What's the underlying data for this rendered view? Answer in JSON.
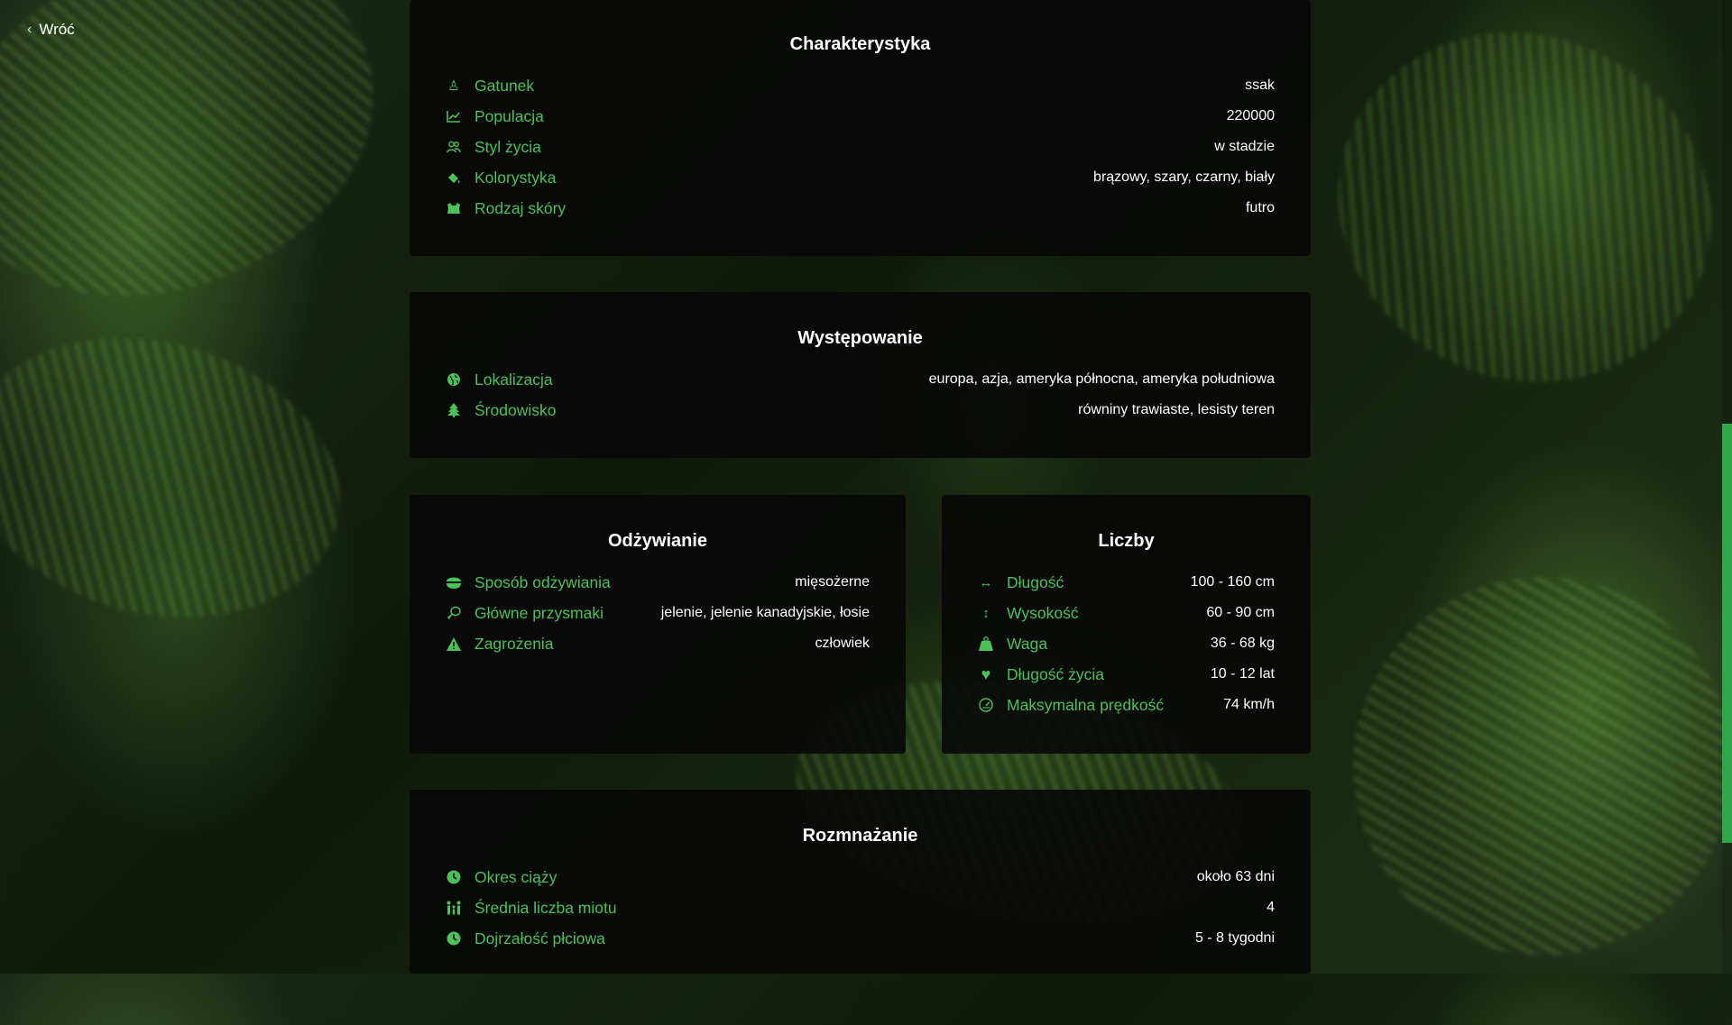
{
  "nav": {
    "back_label": "Wróć"
  },
  "sections": {
    "charakterystyka": {
      "title": "Charakterystyka",
      "rows": [
        {
          "icon": "species-icon",
          "label": "Gatunek",
          "value": "ssak"
        },
        {
          "icon": "chart-line-icon",
          "label": "Populacja",
          "value": "220000"
        },
        {
          "icon": "users-icon",
          "label": "Styl życia",
          "value": "w stadzie"
        },
        {
          "icon": "paint-bucket-icon",
          "label": "Kolorystyka",
          "value": "brązowy, szary, czarny, biały"
        },
        {
          "icon": "skin-icon",
          "label": "Rodzaj skóry",
          "value": "futro"
        }
      ]
    },
    "wystepowanie": {
      "title": "Występowanie",
      "rows": [
        {
          "icon": "globe-icon",
          "label": "Lokalizacja",
          "value": "europa, azja, ameryka północna, ameryka południowa"
        },
        {
          "icon": "tree-icon",
          "label": "Środowisko",
          "value": "równiny trawiaste, lesisty teren"
        }
      ]
    },
    "odzywianie": {
      "title": "Odżywianie",
      "rows": [
        {
          "icon": "bowl-icon",
          "label": "Sposób odżywiania",
          "value": "mięsożerne"
        },
        {
          "icon": "drumstick-icon",
          "label": "Główne przysmaki",
          "value": "jelenie, jelenie kanadyjskie, łosie"
        },
        {
          "icon": "warning-icon",
          "label": "Zagrożenia",
          "value": "człowiek"
        }
      ]
    },
    "liczby": {
      "title": "Liczby",
      "rows": [
        {
          "icon": "arrows-horizontal-icon",
          "label": "Długość",
          "value": "100 - 160 cm"
        },
        {
          "icon": "arrows-vertical-icon",
          "label": "Wysokość",
          "value": "60 - 90 cm"
        },
        {
          "icon": "weight-icon",
          "label": "Waga",
          "value": "36 - 68 kg"
        },
        {
          "icon": "heart-icon",
          "label": "Długość życia",
          "value": "10 - 12 lat"
        },
        {
          "icon": "speedometer-icon",
          "label": "Maksymalna prędkość",
          "value": "74 km/h"
        }
      ]
    },
    "rozmnazanie": {
      "title": "Rozmnażanie",
      "rows": [
        {
          "icon": "clock-icon",
          "label": "Okres ciąży",
          "value": "około 63 dni"
        },
        {
          "icon": "family-icon",
          "label": "Średnia liczba miotu",
          "value": "4"
        },
        {
          "icon": "clock-icon",
          "label": "Dojrzałość płciowa",
          "value": "5 - 8 tygodni"
        }
      ]
    }
  },
  "colors": {
    "accent": "#4cc158",
    "card_bg": "#080808",
    "scroll_thumb": "#2ea84a"
  }
}
